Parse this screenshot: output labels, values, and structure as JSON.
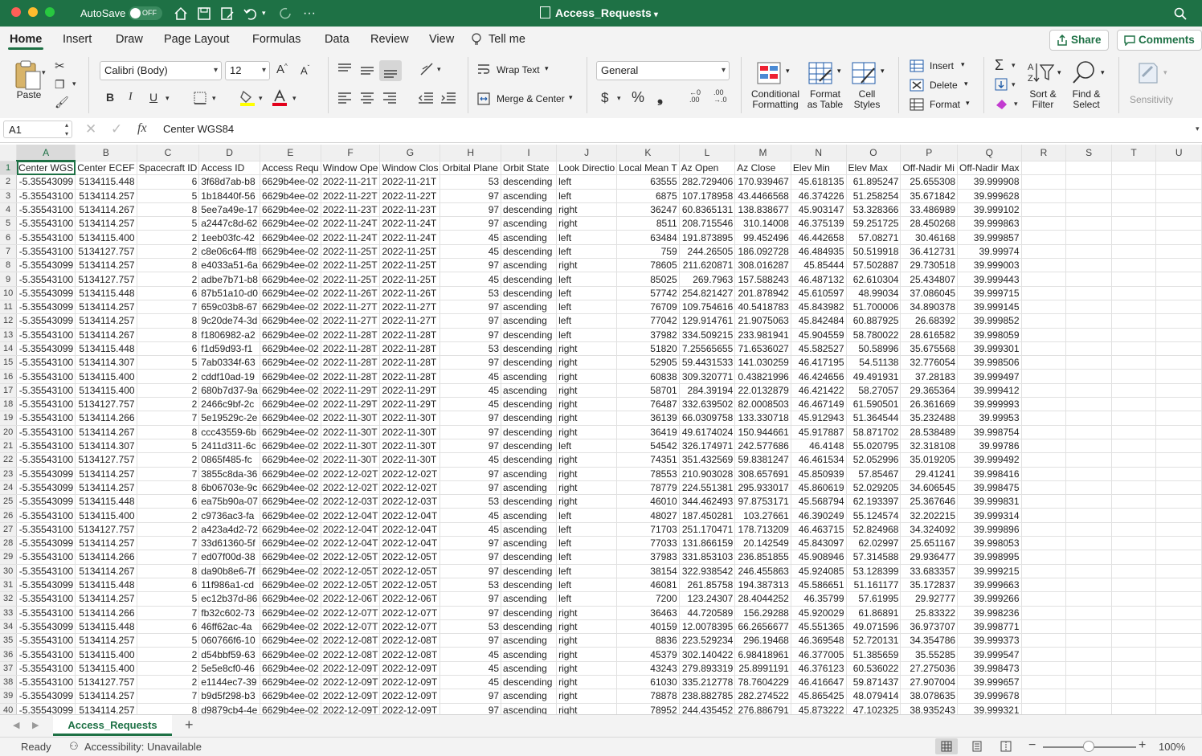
{
  "titlebar": {
    "autosave_label": "AutoSave",
    "autosave_state": "OFF",
    "doc_title": "Access_Requests"
  },
  "ribbon_tabs": [
    "Home",
    "Insert",
    "Draw",
    "Page Layout",
    "Formulas",
    "Data",
    "Review",
    "View"
  ],
  "tell_me": "Tell me",
  "share_label": "Share",
  "comments_label": "Comments",
  "ribbon": {
    "paste": "Paste",
    "font_name": "Calibri (Body)",
    "font_size": "12",
    "wrap_text": "Wrap Text",
    "merge_center": "Merge & Center",
    "number_format": "General",
    "conditional_formatting": [
      "Conditional",
      "Formatting"
    ],
    "format_as_table": [
      "Format",
      "as Table"
    ],
    "cell_styles": [
      "Cell",
      "Styles"
    ],
    "insert": "Insert",
    "delete": "Delete",
    "format": "Format",
    "sort_filter": [
      "Sort &",
      "Filter"
    ],
    "find_select": [
      "Find &",
      "Select"
    ],
    "sensitivity": "Sensitivity"
  },
  "formula_bar": {
    "name_box": "A1",
    "fx": "fx",
    "formula": "Center WGS84"
  },
  "columns": [
    "A",
    "B",
    "C",
    "D",
    "E",
    "F",
    "G",
    "H",
    "I",
    "J",
    "K",
    "L",
    "M",
    "N",
    "O",
    "P",
    "Q",
    "R",
    "S",
    "T",
    "U"
  ],
  "header_row": [
    "Center WGS",
    "Center ECEF",
    "Spacecraft ID",
    "Access ID",
    "Access Requ",
    "Window Ope",
    "Window Clos",
    "Orbital Plane",
    "Orbit State",
    "Look Directio",
    "Local Mean T",
    "Az Open",
    "Az Close",
    "Elev Min",
    "Elev Max",
    "Off-Nadir Mi",
    "Off-Nadir Max"
  ],
  "rows": [
    [
      "-5.35543099",
      "5134115.448",
      "6",
      "3f68d7ab-b8",
      "6629b4ee-02",
      "2022-11-21T",
      "2022-11-21T",
      "53",
      "descending",
      "left",
      "63555",
      "282.729406",
      "170.939467",
      "45.618135",
      "61.895247",
      "25.655308",
      "39.999908"
    ],
    [
      "-5.35543100",
      "5134114.257",
      "5",
      "1b18440f-56",
      "6629b4ee-02",
      "2022-11-22T",
      "2022-11-22T",
      "97",
      "ascending",
      "left",
      "6875",
      "107.178958",
      "43.4466568",
      "46.374226",
      "51.258254",
      "35.671842",
      "39.999628"
    ],
    [
      "-5.35543100",
      "5134114.267",
      "8",
      "5ee7a49e-17",
      "6629b4ee-02",
      "2022-11-23T",
      "2022-11-23T",
      "97",
      "descending",
      "right",
      "36247",
      "60.8365131",
      "138.838677",
      "45.903147",
      "53.328366",
      "33.486989",
      "39.999102"
    ],
    [
      "-5.35543100",
      "5134114.257",
      "5",
      "a2447c8d-62",
      "6629b4ee-02",
      "2022-11-24T",
      "2022-11-24T",
      "97",
      "ascending",
      "right",
      "8511",
      "208.715546",
      "310.14008",
      "46.375139",
      "59.251725",
      "28.450268",
      "39.999863"
    ],
    [
      "-5.35543100",
      "5134115.400",
      "2",
      "1eeb03fc-42",
      "6629b4ee-02",
      "2022-11-24T",
      "2022-11-24T",
      "45",
      "ascending",
      "left",
      "63484",
      "191.873895",
      "99.452496",
      "46.442658",
      "57.08271",
      "30.46168",
      "39.999857"
    ],
    [
      "-5.35543100",
      "5134127.757",
      "2",
      "c8e06c64-ff8",
      "6629b4ee-02",
      "2022-11-25T",
      "2022-11-25T",
      "45",
      "descending",
      "left",
      "759",
      "244.26505",
      "186.092728",
      "46.484935",
      "50.519918",
      "36.412731",
      "39.99974"
    ],
    [
      "-5.35543099",
      "5134114.257",
      "8",
      "e4033a51-6a",
      "6629b4ee-02",
      "2022-11-25T",
      "2022-11-25T",
      "97",
      "ascending",
      "right",
      "78605",
      "211.620871",
      "308.016287",
      "45.85444",
      "57.502887",
      "29.730518",
      "39.999003"
    ],
    [
      "-5.35543100",
      "5134127.757",
      "2",
      "adbe7b71-b8",
      "6629b4ee-02",
      "2022-11-25T",
      "2022-11-25T",
      "45",
      "descending",
      "left",
      "85025",
      "269.7963",
      "157.588243",
      "46.487132",
      "62.610304",
      "25.434807",
      "39.999443"
    ],
    [
      "-5.35543099",
      "5134115.448",
      "6",
      "87b51a10-d0",
      "6629b4ee-02",
      "2022-11-26T",
      "2022-11-26T",
      "53",
      "descending",
      "left",
      "57742",
      "254.821427",
      "201.878942",
      "45.610597",
      "48.99034",
      "37.086045",
      "39.999715"
    ],
    [
      "-5.35543099",
      "5134114.257",
      "7",
      "659c03b8-67",
      "6629b4ee-02",
      "2022-11-27T",
      "2022-11-27T",
      "97",
      "ascending",
      "left",
      "76709",
      "109.754616",
      "40.5418783",
      "45.843982",
      "51.700006",
      "34.890378",
      "39.999145"
    ],
    [
      "-5.35543099",
      "5134114.257",
      "8",
      "9c20de74-3d",
      "6629b4ee-02",
      "2022-11-27T",
      "2022-11-27T",
      "97",
      "ascending",
      "left",
      "77042",
      "129.914761",
      "21.9075063",
      "45.842484",
      "60.887925",
      "26.68392",
      "39.999852"
    ],
    [
      "-5.35543100",
      "5134114.267",
      "8",
      "f1806982-a2",
      "6629b4ee-02",
      "2022-11-28T",
      "2022-11-28T",
      "97",
      "descending",
      "left",
      "37982",
      "334.509215",
      "233.981941",
      "45.904559",
      "58.780022",
      "28.616582",
      "39.998059"
    ],
    [
      "-5.35543099",
      "5134115.448",
      "6",
      "f1d59d93-f1",
      "6629b4ee-02",
      "2022-11-28T",
      "2022-11-28T",
      "53",
      "descending",
      "right",
      "51820",
      "7.25565655",
      "71.6536027",
      "45.582527",
      "50.58996",
      "35.675568",
      "39.999301"
    ],
    [
      "-5.35543100",
      "5134114.307",
      "5",
      "7ab0334f-63",
      "6629b4ee-02",
      "2022-11-28T",
      "2022-11-28T",
      "97",
      "descending",
      "right",
      "52905",
      "59.4431533",
      "141.030259",
      "46.417195",
      "54.51138",
      "32.776054",
      "39.998506"
    ],
    [
      "-5.35543100",
      "5134115.400",
      "2",
      "cddf10ad-19",
      "6629b4ee-02",
      "2022-11-28T",
      "2022-11-28T",
      "45",
      "ascending",
      "right",
      "60838",
      "309.320771",
      "0.43821996",
      "46.424656",
      "49.491931",
      "37.28183",
      "39.999497"
    ],
    [
      "-5.35543100",
      "5134115.400",
      "2",
      "680b7d37-9a",
      "6629b4ee-02",
      "2022-11-29T",
      "2022-11-29T",
      "45",
      "ascending",
      "right",
      "58701",
      "284.39194",
      "22.0132879",
      "46.421422",
      "58.27057",
      "29.365364",
      "39.999412"
    ],
    [
      "-5.35543100",
      "5134127.757",
      "2",
      "2466c9bf-2c",
      "6629b4ee-02",
      "2022-11-29T",
      "2022-11-29T",
      "45",
      "descending",
      "right",
      "76487",
      "332.639502",
      "82.0008503",
      "46.467149",
      "61.590501",
      "26.361669",
      "39.999993"
    ],
    [
      "-5.35543100",
      "5134114.266",
      "7",
      "5e19529c-2e",
      "6629b4ee-02",
      "2022-11-30T",
      "2022-11-30T",
      "97",
      "descending",
      "right",
      "36139",
      "66.0309758",
      "133.330718",
      "45.912943",
      "51.364544",
      "35.232488",
      "39.99953"
    ],
    [
      "-5.35543100",
      "5134114.267",
      "8",
      "ccc43559-6b",
      "6629b4ee-02",
      "2022-11-30T",
      "2022-11-30T",
      "97",
      "descending",
      "right",
      "36419",
      "49.6174024",
      "150.944661",
      "45.917887",
      "58.871702",
      "28.538489",
      "39.998754"
    ],
    [
      "-5.35543100",
      "5134114.307",
      "5",
      "2411d311-6c",
      "6629b4ee-02",
      "2022-11-30T",
      "2022-11-30T",
      "97",
      "descending",
      "left",
      "54542",
      "326.174971",
      "242.577686",
      "46.4148",
      "55.020795",
      "32.318108",
      "39.99786"
    ],
    [
      "-5.35543100",
      "5134127.757",
      "2",
      "0865f485-fc",
      "6629b4ee-02",
      "2022-11-30T",
      "2022-11-30T",
      "45",
      "descending",
      "right",
      "74351",
      "351.432569",
      "59.8381247",
      "46.461534",
      "52.052996",
      "35.019205",
      "39.999492"
    ],
    [
      "-5.35543099",
      "5134114.257",
      "7",
      "3855c8da-36",
      "6629b4ee-02",
      "2022-12-02T",
      "2022-12-02T",
      "97",
      "ascending",
      "right",
      "78553",
      "210.903028",
      "308.657691",
      "45.850939",
      "57.85467",
      "29.41241",
      "39.998416"
    ],
    [
      "-5.35543099",
      "5134114.257",
      "8",
      "6b06703e-9c",
      "6629b4ee-02",
      "2022-12-02T",
      "2022-12-02T",
      "97",
      "ascending",
      "right",
      "78779",
      "224.551381",
      "295.933017",
      "45.860619",
      "52.029205",
      "34.606545",
      "39.998475"
    ],
    [
      "-5.35543099",
      "5134115.448",
      "6",
      "ea75b90a-07",
      "6629b4ee-02",
      "2022-12-03T",
      "2022-12-03T",
      "53",
      "descending",
      "right",
      "46010",
      "344.462493",
      "97.8753171",
      "45.568794",
      "62.193397",
      "25.367646",
      "39.999831"
    ],
    [
      "-5.35543100",
      "5134115.400",
      "2",
      "c9736ac3-fa",
      "6629b4ee-02",
      "2022-12-04T",
      "2022-12-04T",
      "45",
      "ascending",
      "left",
      "48027",
      "187.450281",
      "103.27661",
      "46.390249",
      "55.124574",
      "32.202215",
      "39.999314"
    ],
    [
      "-5.35543100",
      "5134127.757",
      "2",
      "a423a4d2-72",
      "6629b4ee-02",
      "2022-12-04T",
      "2022-12-04T",
      "45",
      "ascending",
      "left",
      "71703",
      "251.170471",
      "178.713209",
      "46.463715",
      "52.824968",
      "34.324092",
      "39.999896"
    ],
    [
      "-5.35543099",
      "5134114.257",
      "7",
      "33d61360-5f",
      "6629b4ee-02",
      "2022-12-04T",
      "2022-12-04T",
      "97",
      "ascending",
      "left",
      "77033",
      "131.866159",
      "20.142549",
      "45.843097",
      "62.02997",
      "25.651167",
      "39.998053"
    ],
    [
      "-5.35543100",
      "5134114.266",
      "7",
      "ed07f00d-38",
      "6629b4ee-02",
      "2022-12-05T",
      "2022-12-05T",
      "97",
      "descending",
      "left",
      "37983",
      "331.853103",
      "236.851855",
      "45.908946",
      "57.314588",
      "29.936477",
      "39.998995"
    ],
    [
      "-5.35543100",
      "5134114.267",
      "8",
      "da90b8e6-7f",
      "6629b4ee-02",
      "2022-12-05T",
      "2022-12-05T",
      "97",
      "descending",
      "left",
      "38154",
      "322.938542",
      "246.455863",
      "45.924085",
      "53.128399",
      "33.683357",
      "39.999215"
    ],
    [
      "-5.35543099",
      "5134115.448",
      "6",
      "11f986a1-cd",
      "6629b4ee-02",
      "2022-12-05T",
      "2022-12-05T",
      "53",
      "descending",
      "left",
      "46081",
      "261.85758",
      "194.387313",
      "45.586651",
      "51.161177",
      "35.172837",
      "39.999663"
    ],
    [
      "-5.35543100",
      "5134114.257",
      "5",
      "ec12b37d-86",
      "6629b4ee-02",
      "2022-12-06T",
      "2022-12-06T",
      "97",
      "ascending",
      "left",
      "7200",
      "123.24307",
      "28.4044252",
      "46.35799",
      "57.61995",
      "29.92777",
      "39.999266"
    ],
    [
      "-5.35543100",
      "5134114.266",
      "7",
      "fb32c602-73",
      "6629b4ee-02",
      "2022-12-07T",
      "2022-12-07T",
      "97",
      "descending",
      "right",
      "36463",
      "44.720589",
      "156.29288",
      "45.920029",
      "61.86891",
      "25.83322",
      "39.998236"
    ],
    [
      "-5.35543099",
      "5134115.448",
      "6",
      "46ff62ac-4a",
      "6629b4ee-02",
      "2022-12-07T",
      "2022-12-07T",
      "53",
      "descending",
      "right",
      "40159",
      "12.0078395",
      "66.2656677",
      "45.551365",
      "49.071596",
      "36.973707",
      "39.998771"
    ],
    [
      "-5.35543100",
      "5134114.257",
      "5",
      "060766f6-10",
      "6629b4ee-02",
      "2022-12-08T",
      "2022-12-08T",
      "97",
      "ascending",
      "right",
      "8836",
      "223.529234",
      "296.19468",
      "46.369548",
      "52.720131",
      "34.354786",
      "39.999373"
    ],
    [
      "-5.35543100",
      "5134115.400",
      "2",
      "d54bbf59-63",
      "6629b4ee-02",
      "2022-12-08T",
      "2022-12-08T",
      "45",
      "ascending",
      "right",
      "45379",
      "302.140422",
      "6.98418961",
      "46.377005",
      "51.385659",
      "35.55285",
      "39.999547"
    ],
    [
      "-5.35543100",
      "5134115.400",
      "2",
      "5e5e8cf0-46",
      "6629b4ee-02",
      "2022-12-09T",
      "2022-12-09T",
      "45",
      "ascending",
      "right",
      "43243",
      "279.893319",
      "25.8991191",
      "46.376123",
      "60.536022",
      "27.275036",
      "39.998473"
    ],
    [
      "-5.35543100",
      "5134127.757",
      "2",
      "e1144ec7-39",
      "6629b4ee-02",
      "2022-12-09T",
      "2022-12-09T",
      "45",
      "descending",
      "right",
      "61030",
      "335.212778",
      "78.7604229",
      "46.416647",
      "59.871437",
      "27.907004",
      "39.999657"
    ],
    [
      "-5.35543099",
      "5134114.257",
      "7",
      "b9d5f298-b3",
      "6629b4ee-02",
      "2022-12-09T",
      "2022-12-09T",
      "97",
      "ascending",
      "right",
      "78878",
      "238.882785",
      "282.274522",
      "45.865425",
      "48.079414",
      "38.078635",
      "39.999678"
    ],
    [
      "-5.35543099",
      "5134114.257",
      "8",
      "d9879cb4-4e",
      "6629b4ee-02",
      "2022-12-09T",
      "2022-12-09T",
      "97",
      "ascending",
      "right",
      "78952",
      "244.435452",
      "276.886791",
      "45.873222",
      "47.102325",
      "38.935243",
      "39.999321"
    ]
  ],
  "sheet_tab": "Access_Requests",
  "status": {
    "ready": "Ready",
    "accessibility": "Accessibility: Unavailable",
    "zoom": "100%"
  },
  "colors": {
    "brand_green": "#1e7145",
    "ribbon_bg": "#f3f3f3"
  }
}
